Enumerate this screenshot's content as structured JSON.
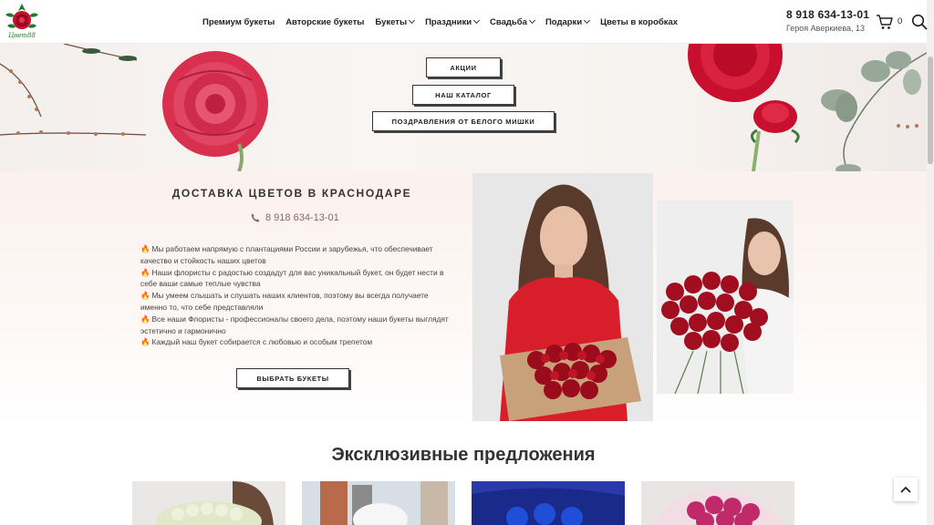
{
  "header": {
    "nav": [
      {
        "label": "Премиум букеты",
        "dropdown": false
      },
      {
        "label": "Авторские букеты",
        "dropdown": false
      },
      {
        "label": "Букеты",
        "dropdown": true
      },
      {
        "label": "Праздники",
        "dropdown": true
      },
      {
        "label": "Свадьба",
        "dropdown": true
      },
      {
        "label": "Подарки",
        "dropdown": true
      },
      {
        "label": "Цветы в коробках",
        "dropdown": false
      }
    ],
    "phone": "8 918 634-13-01",
    "address": "Героя Аверкиева, 13",
    "cart_count": "0",
    "logo_text": "Цвет88"
  },
  "hero": {
    "buttons": [
      "АКЦИИ",
      "НАШ КАТАЛОГ",
      "ПОЗДРАВЛЕНИЯ ОТ БЕЛОГО МИШКИ"
    ]
  },
  "info": {
    "title": "ДОСТАВКА ЦВЕТОВ В КРАСНОДАРЕ",
    "phone": "8 918 634-13-01",
    "bullets": [
      "Мы работаем напрямую с плантациями России и зарубежья, что обеспечивает качество и стойкость наших цветов",
      "Наши флористы с радостью создадут для вас уникальный букет, он будет нести в себе ваши самые теплые чувства",
      "Мы умеем слышать и слушать наших клиентов, поэтому вы всегда получаете именно то, что себе представляли",
      "Все наши Флористы - профессионалы своего дела, поэтому наши букеты выглядят эстетично и гармонично",
      "Каждый наш букет собирается с любовью и особым трепетом"
    ],
    "button": "ВЫБРАТЬ БУКЕТЫ"
  },
  "exclusive": {
    "title": "Эксклюзивные предложения"
  },
  "colors": {
    "accent": "#c8102e",
    "phone_brown": "#8a6a5a",
    "fire": "#f08a1c"
  }
}
